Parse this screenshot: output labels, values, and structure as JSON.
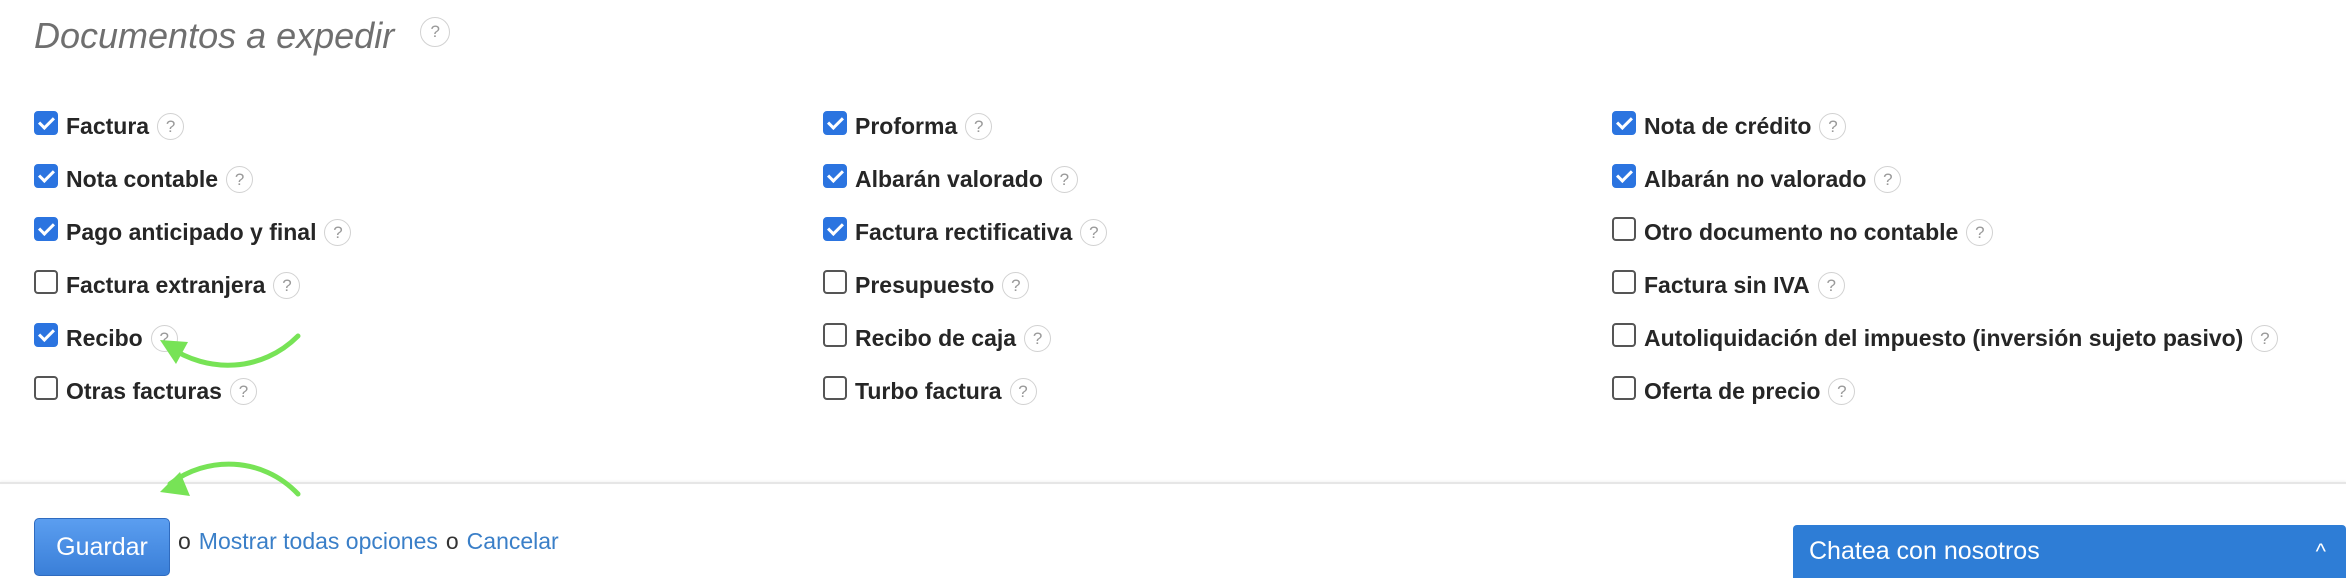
{
  "section": {
    "title": "Documentos a expedir",
    "help": "?"
  },
  "options": {
    "col1": [
      {
        "label": "Factura",
        "checked": true
      },
      {
        "label": "Nota contable",
        "checked": true
      },
      {
        "label": "Pago anticipado y final",
        "checked": true
      },
      {
        "label": "Factura extranjera",
        "checked": false
      },
      {
        "label": "Recibo",
        "checked": true
      },
      {
        "label": "Otras facturas",
        "checked": false
      }
    ],
    "col2": [
      {
        "label": "Proforma",
        "checked": true
      },
      {
        "label": "Albarán valorado",
        "checked": true
      },
      {
        "label": "Factura rectificativa",
        "checked": true
      },
      {
        "label": "Presupuesto",
        "checked": false
      },
      {
        "label": "Recibo de caja",
        "checked": false
      },
      {
        "label": "Turbo factura",
        "checked": false
      }
    ],
    "col3": [
      {
        "label": "Nota de crédito",
        "checked": true
      },
      {
        "label": "Albarán no valorado",
        "checked": true
      },
      {
        "label": "Otro documento no contable",
        "checked": false
      },
      {
        "label": "Factura sin IVA",
        "checked": false
      },
      {
        "label": "Autoliquidación del impuesto (inversión sujeto pasivo)",
        "checked": false
      },
      {
        "label": "Oferta de precio",
        "checked": false
      }
    ]
  },
  "actions": {
    "save_label": "Guardar",
    "or_1": "o",
    "show_all_label": "Mostrar todas opciones",
    "or_2": "o",
    "cancel_label": "Cancelar"
  },
  "chat": {
    "label": "Chatea con nosotros",
    "chevron": "^"
  },
  "colors": {
    "checkbox_checked": "#2b74e0",
    "link": "#3a7fc8",
    "save_button": "#3a7fd8",
    "chat_bar": "#2e7dd6",
    "annotation_arrow": "#77e356"
  }
}
